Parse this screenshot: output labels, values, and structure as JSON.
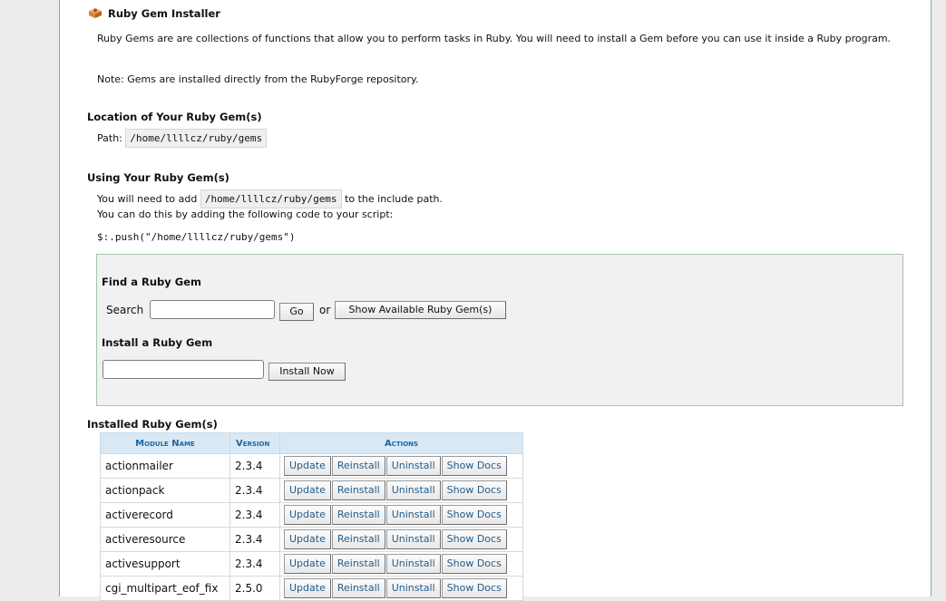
{
  "header": {
    "title": "Ruby Gem Installer"
  },
  "intro": {
    "text": "Ruby Gems are are collections of functions that allow you to perform tasks in Ruby. You will need to install a Gem before you can use it inside a Ruby program.",
    "note": "Note: Gems are installed directly from the RubyForge repository."
  },
  "location": {
    "heading": "Location of Your Ruby Gem(s)",
    "path_label": "Path:",
    "path": "/home/llllcz/ruby/gems"
  },
  "using": {
    "heading": "Using Your Ruby Gem(s)",
    "line1_pre": "You will need to add",
    "line1_path": "/home/llllcz/ruby/gems",
    "line1_post": "to the include path.",
    "line2": "You can do this by adding the following code to your script:",
    "code": "$:.push(\"/home/llllcz/ruby/gems\")"
  },
  "find": {
    "heading": "Find a Ruby Gem",
    "search_label": "Search",
    "search_value": "",
    "go_label": "Go",
    "or_label": "or",
    "show_available_label": "Show Available Ruby Gem(s)"
  },
  "install": {
    "heading": "Install a Ruby Gem",
    "value": "",
    "button_label": "Install Now"
  },
  "installed": {
    "heading": "Installed Ruby Gem(s)",
    "columns": [
      "Module Name",
      "Version",
      "Actions"
    ],
    "action_labels": [
      "Update",
      "Reinstall",
      "Uninstall",
      "Show Docs"
    ],
    "rows": [
      {
        "name": "actionmailer",
        "version": "2.3.4"
      },
      {
        "name": "actionpack",
        "version": "2.3.4"
      },
      {
        "name": "activerecord",
        "version": "2.3.4"
      },
      {
        "name": "activeresource",
        "version": "2.3.4"
      },
      {
        "name": "activesupport",
        "version": "2.3.4"
      },
      {
        "name": "cgi_multipart_eof_fix",
        "version": "2.5.0"
      }
    ]
  },
  "colors": {
    "panel_border": "#7fb27f",
    "table_header_bg": "#d8e8f4",
    "table_header_text": "#1f66a0",
    "action_text": "#245c8a"
  },
  "icons": {
    "title": "gem-box-icon"
  }
}
